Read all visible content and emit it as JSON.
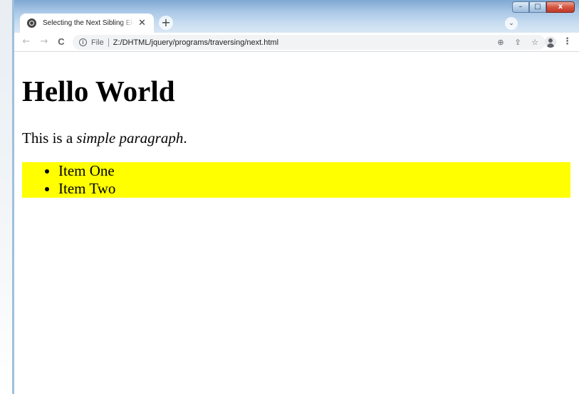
{
  "browser": {
    "tab": {
      "title": "Selecting the Next Sibling Element",
      "close_glyph": "✕"
    },
    "newtab_glyph": "+",
    "tabsearch_glyph": "⌄",
    "window_controls": {
      "minimize_glyph": "–",
      "maximize_glyph": "□",
      "close_glyph": "x"
    },
    "toolbar": {
      "back_glyph": "←",
      "forward_glyph": "→",
      "reload_glyph": "C",
      "scheme_label": "File",
      "url": "Z:/DHTML/jquery/programs/traversing/next.html",
      "zoom_glyph": "⊕",
      "share_glyph": "⇪",
      "bookmark_glyph": "☆",
      "menu_glyph": "⋮"
    }
  },
  "page": {
    "heading": "Hello World",
    "paragraph_prefix": "This is a ",
    "paragraph_emphasis": "simple paragraph",
    "paragraph_suffix": ".",
    "list_items": [
      "Item One",
      "Item Two"
    ],
    "list_highlight_color": "#ffff00"
  }
}
